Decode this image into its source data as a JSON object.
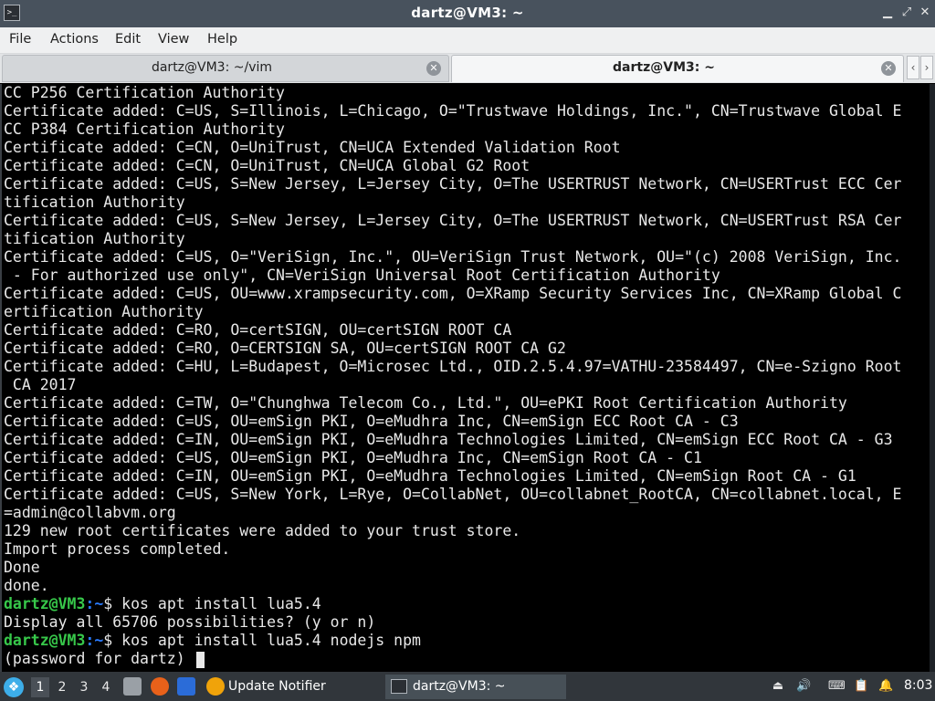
{
  "window": {
    "title": "dartz@VM3: ~",
    "icon": "terminal-icon",
    "controls": [
      "minimize",
      "maximize",
      "close"
    ]
  },
  "menu": [
    "File",
    "Actions",
    "Edit",
    "View",
    "Help"
  ],
  "tabs": [
    {
      "label": "dartz@VM3: ~/vim",
      "active": false
    },
    {
      "label": "dartz@VM3: ~",
      "active": true
    }
  ],
  "terminal": {
    "colors": {
      "prompt_user": "#37c84a",
      "prompt_path": "#2a7bff",
      "text": "#e8e8e8",
      "background": "#000000"
    },
    "lines": [
      {
        "text": "CC P256 Certification Authority"
      },
      {
        "text": "Certificate added: C=US, S=Illinois, L=Chicago, O=\"Trustwave Holdings, Inc.\", CN=Trustwave Global E"
      },
      {
        "text": "CC P384 Certification Authority"
      },
      {
        "text": "Certificate added: C=CN, O=UniTrust, CN=UCA Extended Validation Root"
      },
      {
        "text": "Certificate added: C=CN, O=UniTrust, CN=UCA Global G2 Root"
      },
      {
        "text": "Certificate added: C=US, S=New Jersey, L=Jersey City, O=The USERTRUST Network, CN=USERTrust ECC Cer"
      },
      {
        "text": "tification Authority"
      },
      {
        "text": "Certificate added: C=US, S=New Jersey, L=Jersey City, O=The USERTRUST Network, CN=USERTrust RSA Cer"
      },
      {
        "text": "tification Authority"
      },
      {
        "text": "Certificate added: C=US, O=\"VeriSign, Inc.\", OU=VeriSign Trust Network, OU=\"(c) 2008 VeriSign, Inc."
      },
      {
        "text": " - For authorized use only\", CN=VeriSign Universal Root Certification Authority"
      },
      {
        "text": "Certificate added: C=US, OU=www.xrampsecurity.com, O=XRamp Security Services Inc, CN=XRamp Global C"
      },
      {
        "text": "ertification Authority"
      },
      {
        "text": "Certificate added: C=RO, O=certSIGN, OU=certSIGN ROOT CA"
      },
      {
        "text": "Certificate added: C=RO, O=CERTSIGN SA, OU=certSIGN ROOT CA G2"
      },
      {
        "text": "Certificate added: C=HU, L=Budapest, O=Microsec Ltd., OID.2.5.4.97=VATHU-23584497, CN=e-Szigno Root"
      },
      {
        "text": " CA 2017"
      },
      {
        "text": "Certificate added: C=TW, O=\"Chunghwa Telecom Co., Ltd.\", OU=ePKI Root Certification Authority"
      },
      {
        "text": "Certificate added: C=US, OU=emSign PKI, O=eMudhra Inc, CN=emSign ECC Root CA - C3"
      },
      {
        "text": "Certificate added: C=IN, OU=emSign PKI, O=eMudhra Technologies Limited, CN=emSign ECC Root CA - G3"
      },
      {
        "text": "Certificate added: C=US, OU=emSign PKI, O=eMudhra Inc, CN=emSign Root CA - C1"
      },
      {
        "text": "Certificate added: C=IN, OU=emSign PKI, O=eMudhra Technologies Limited, CN=emSign Root CA - G1"
      },
      {
        "text": "Certificate added: C=US, S=New York, L=Rye, O=CollabNet, OU=collabnet_RootCA, CN=collabnet.local, E"
      },
      {
        "text": "=admin@collabvm.org"
      },
      {
        "text": "129 new root certificates were added to your trust store."
      },
      {
        "text": "Import process completed."
      },
      {
        "text": "Done"
      },
      {
        "text": "done."
      },
      {
        "prompt_user": "dartz@VM3",
        "prompt_sep": ":",
        "prompt_path": "~",
        "prompt_symbol": "$",
        "text": " kos apt install lua5.4"
      },
      {
        "text": "Display all 65706 possibilities? (y or n)"
      },
      {
        "prompt_user": "dartz@VM3",
        "prompt_sep": ":",
        "prompt_path": "~",
        "prompt_symbol": "$",
        "text": " kos apt install lua5.4 nodejs npm"
      },
      {
        "text": "(password for dartz) ",
        "cursor": true
      }
    ]
  },
  "taskbar": {
    "workspaces": [
      "1",
      "2",
      "3",
      "4"
    ],
    "active_workspace": "1",
    "tasks": [
      {
        "label": "Update Notifier",
        "icon": "update-notifier-icon",
        "active": false
      },
      {
        "label": "dartz@VM3: ~",
        "icon": "terminal-icon",
        "active": true
      }
    ],
    "clock": "8:03"
  }
}
